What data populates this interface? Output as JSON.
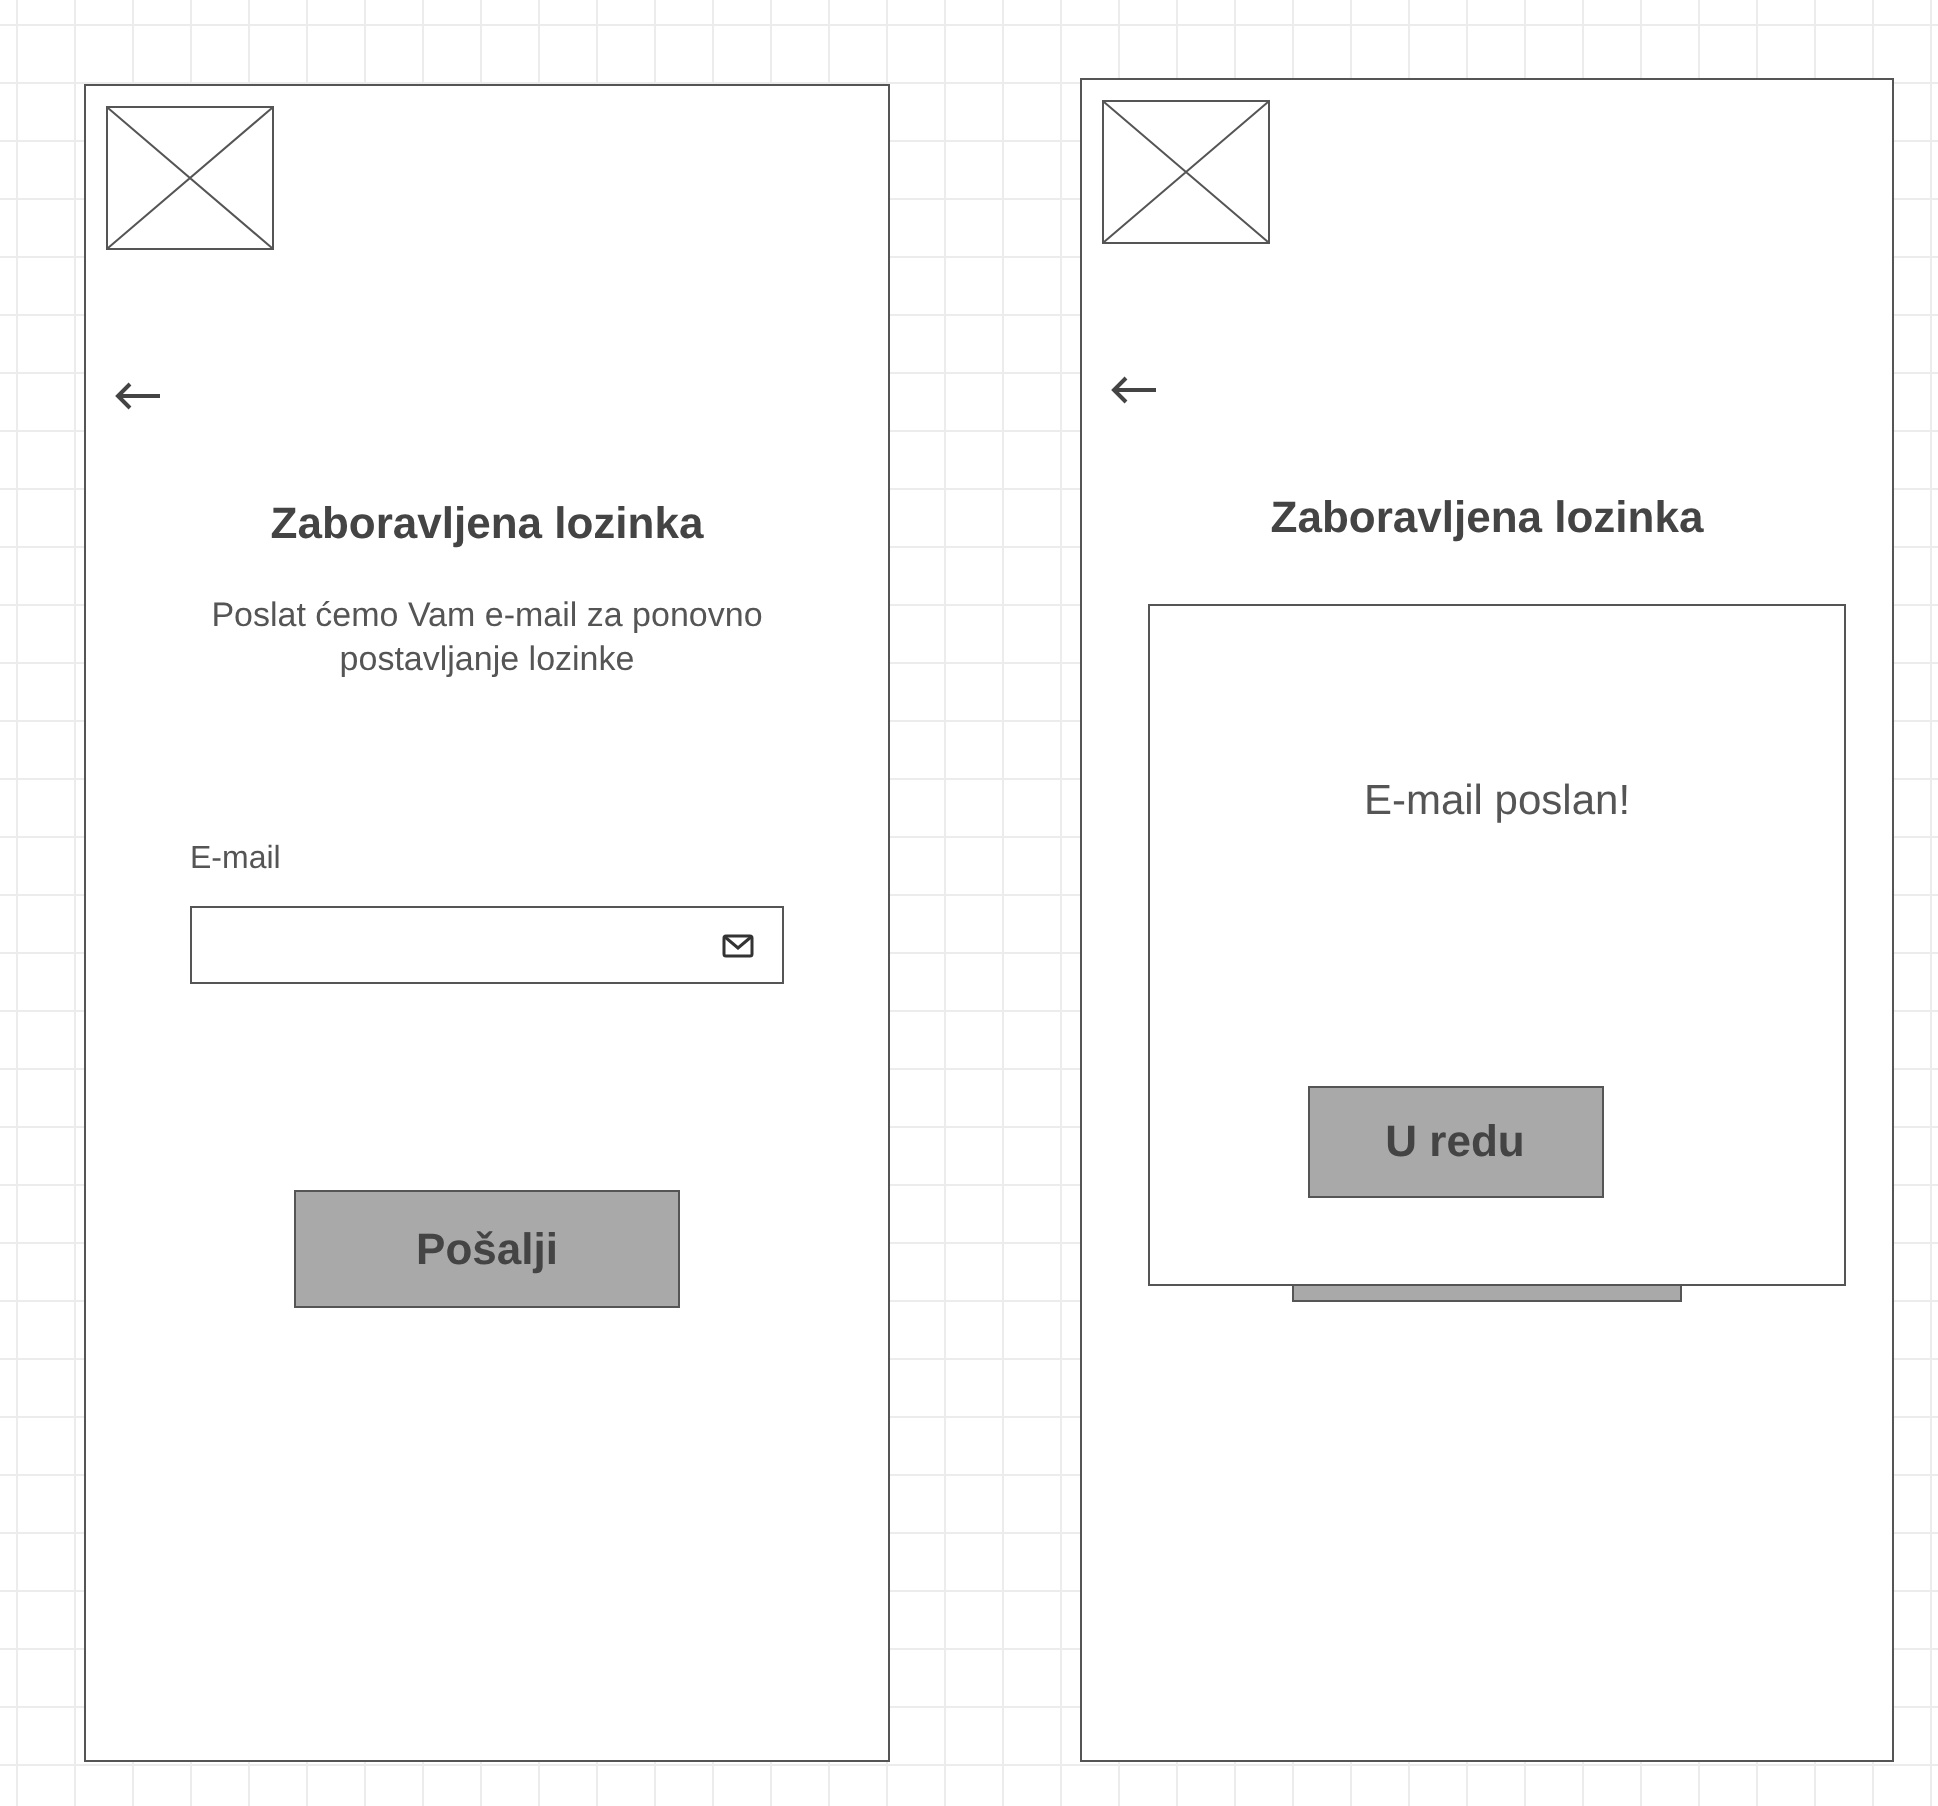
{
  "screens": [
    {
      "title": "Zaboravljena lozinka",
      "subtitle": "Poslat ćemo Vam e-mail za ponovno postavljanje lozinke",
      "field_label": "E-mail",
      "button": "Pošalji"
    },
    {
      "title": "Zaboravljena lozinka",
      "dialog": {
        "message": "E-mail poslan!",
        "button": "U redu"
      }
    }
  ]
}
